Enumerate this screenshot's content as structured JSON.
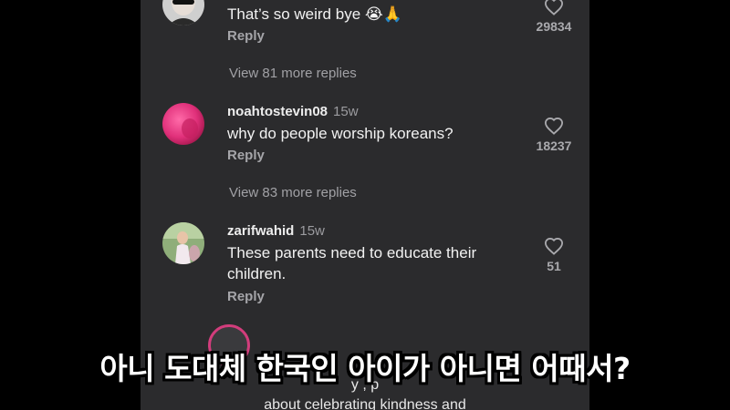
{
  "comments": [
    {
      "username": "",
      "time": "",
      "text": "That’s so weird bye",
      "emoji": "😭🙏",
      "reply": "Reply",
      "likes": "29834"
    },
    {
      "username": "noahtostevin08",
      "time": "15w",
      "text": "why do people worship koreans?",
      "emoji": "",
      "reply": "Reply",
      "likes": "18237"
    },
    {
      "username": "zarifwahid",
      "time": "15w",
      "text": "These parents need to educate their children.",
      "emoji": "",
      "reply": "Reply",
      "likes": "51"
    }
  ],
  "more_replies": [
    "View 81 more replies",
    "View 83 more replies"
  ],
  "bottom_text": {
    "line1": "y                ,                p",
    "line2": "about celebrating kindness and"
  },
  "subtitle": "아니 도대체 한국인 아이가 아니면 어때서?",
  "icons": {
    "like": "heart-outline-icon"
  },
  "colors": {
    "panel_bg": "#2b2b2d",
    "page_bg": "#000000",
    "muted_text": "#a1a1a5",
    "story_ring": "#d23d7c"
  }
}
